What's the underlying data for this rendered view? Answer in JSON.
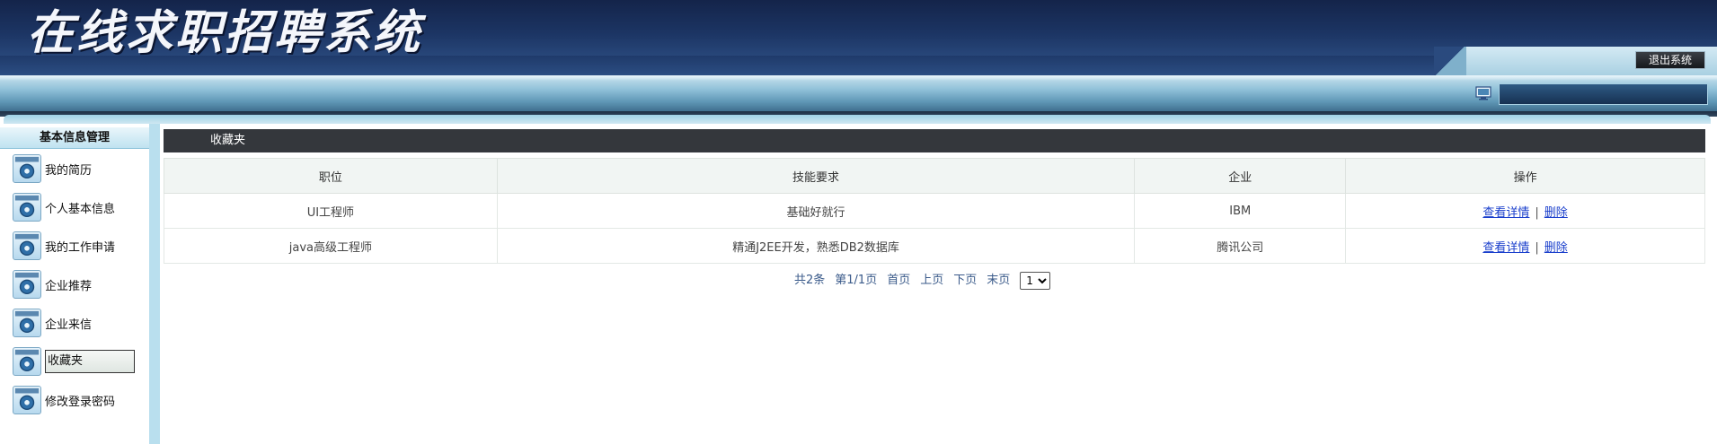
{
  "header": {
    "site_title": "在线求职招聘系统",
    "logout_label": "退出系统"
  },
  "sidebar": {
    "heading": "基本信息管理",
    "items": [
      {
        "label": "我的简历"
      },
      {
        "label": "个人基本信息"
      },
      {
        "label": "我的工作申请"
      },
      {
        "label": "企业推荐"
      },
      {
        "label": "企业来信"
      },
      {
        "label": "收藏夹"
      },
      {
        "label": "修改登录密码"
      }
    ],
    "active_item": "收藏夹"
  },
  "main": {
    "title": "收藏夹",
    "table": {
      "headers": [
        "职位",
        "技能要求",
        "企业",
        "操作"
      ],
      "rows": [
        {
          "position": "UI工程师",
          "skills": "基础好就行",
          "company": "IBM",
          "view": "查看详情",
          "sep": "|",
          "delete": "删除"
        },
        {
          "position": "java高级工程师",
          "skills": "精通J2EE开发，熟悉DB2数据库",
          "company": "腾讯公司",
          "view": "查看详情",
          "sep": "|",
          "delete": "删除"
        }
      ]
    },
    "pager": {
      "total": "共2条",
      "page_info": "第1/1页",
      "first": "首页",
      "prev": "上页",
      "next": "下页",
      "last": "末页",
      "selected_page": "1"
    }
  },
  "colors": {
    "banner": "#1c3564",
    "title_bar": "#34373c",
    "link": "#1a3fcc",
    "sidebar_border": "#b9dfee"
  }
}
